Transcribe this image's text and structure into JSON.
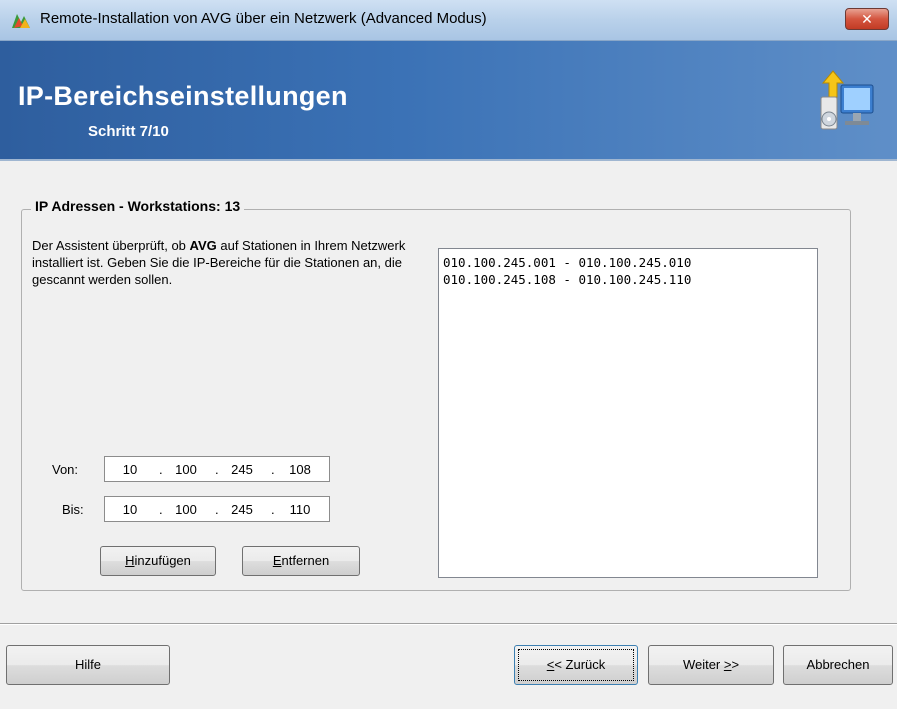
{
  "window": {
    "title": "Remote-Installation von AVG über ein Netzwerk (Advanced Modus)",
    "close_label": "✕",
    "app_icon": "avg-logo-icon"
  },
  "header": {
    "title": "IP-Bereichseinstellungen",
    "step": "Schritt 7/10",
    "icon": "network-install-computer-icon"
  },
  "group": {
    "legend": "IP Adressen - Workstations: 13",
    "description_part1": "Der Assistent überprüft, ob ",
    "description_bold": "AVG",
    "description_part2": " auf Stationen in Ihrem Netzwerk installiert ist. Geben Sie die IP-Bereiche für die Stationen an, die gescannt werden sollen."
  },
  "range": {
    "from_label": "Von:",
    "from": [
      "10",
      "100",
      "245",
      "108"
    ],
    "to_label": "Bis:",
    "to": [
      "10",
      "100",
      "245",
      "110"
    ],
    "add_button": {
      "accel": "H",
      "rest": "inzufügen"
    },
    "remove_button": {
      "accel": "E",
      "rest": "ntfernen"
    }
  },
  "ranges_list": [
    "010.100.245.001 - 010.100.245.010",
    "010.100.245.108 - 010.100.245.110"
  ],
  "footer": {
    "help": "Hilfe",
    "back_accel": "<",
    "back_rest": "< Zurück",
    "next_prefix": "Weiter ",
    "next_accel": ">",
    "next_rest": ">",
    "cancel": "Abbrechen"
  },
  "colors": {
    "banner_dark": "#2e5e9e",
    "banner_light": "#5f8fc8",
    "close_red": "#c23b24"
  }
}
